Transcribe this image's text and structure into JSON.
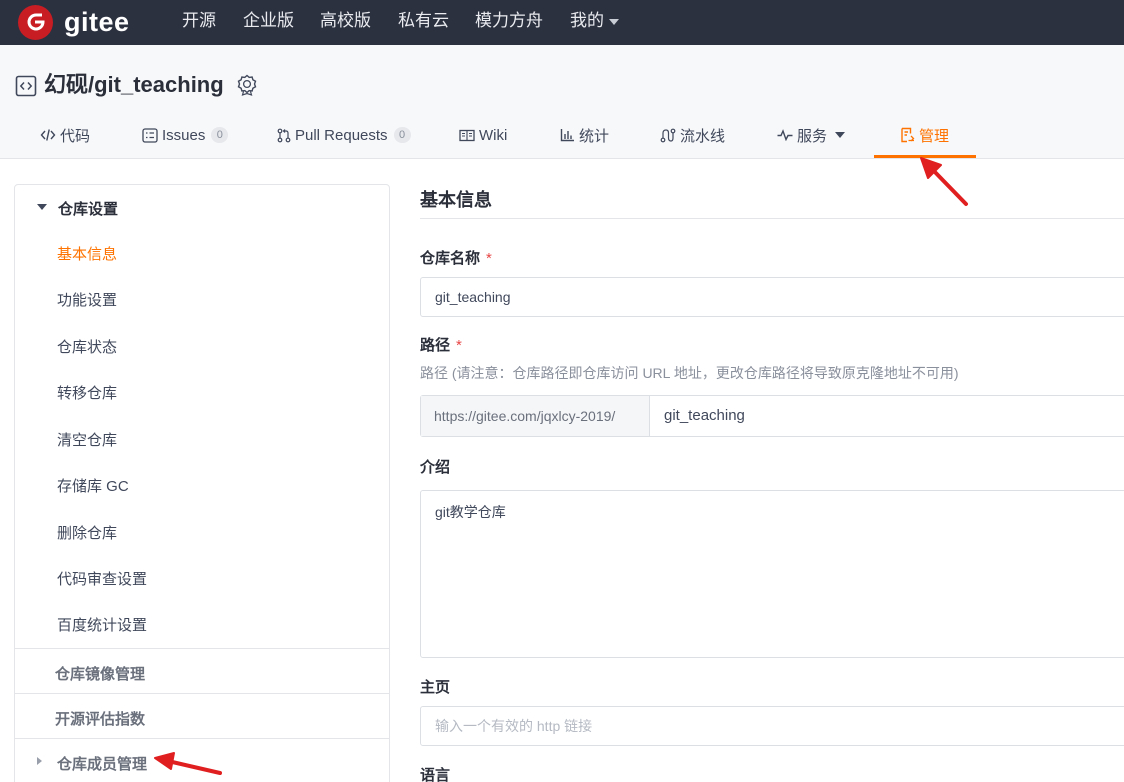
{
  "topbar": {
    "logo_text": "gitee",
    "nav": [
      {
        "label": "开源"
      },
      {
        "label": "企业版"
      },
      {
        "label": "高校版"
      },
      {
        "label": "私有云"
      },
      {
        "label": "模力方舟"
      },
      {
        "label": "我的"
      }
    ]
  },
  "project": {
    "title": "幻砚/git_teaching",
    "tabs": [
      {
        "label": "代码",
        "icon": "code-icon"
      },
      {
        "label": "Issues",
        "count": "0",
        "icon": "issues-icon"
      },
      {
        "label": "Pull Requests",
        "count": "0",
        "icon": "pull-request-icon"
      },
      {
        "label": "Wiki",
        "icon": "wiki-icon"
      },
      {
        "label": "统计",
        "icon": "chart-icon"
      },
      {
        "label": "流水线",
        "icon": "pipeline-icon"
      },
      {
        "label": "服务",
        "icon": "pulse-icon"
      },
      {
        "label": "管理",
        "icon": "manage-icon",
        "active": true
      }
    ]
  },
  "sidebar": {
    "group_title": "仓库设置",
    "items": [
      {
        "label": "基本信息",
        "active": true
      },
      {
        "label": "功能设置"
      },
      {
        "label": "仓库状态"
      },
      {
        "label": "转移仓库"
      },
      {
        "label": "清空仓库"
      },
      {
        "label": "存储库 GC"
      },
      {
        "label": "删除仓库"
      },
      {
        "label": "代码审查设置"
      },
      {
        "label": "百度统计设置"
      }
    ],
    "groups": [
      {
        "label": "仓库镜像管理"
      },
      {
        "label": "开源评估指数"
      },
      {
        "label": "仓库成员管理"
      }
    ]
  },
  "form": {
    "section_title": "基本信息",
    "repo_name_label": "仓库名称",
    "repo_name_value": "git_teaching",
    "path_label": "路径",
    "path_hint": "路径 (请注意：仓库路径即仓库访问 URL 地址，更改仓库路径将导致原克隆地址不可用)",
    "path_prefix": "https://gitee.com/jqxlcy-2019/",
    "path_value": "git_teaching",
    "intro_label": "介绍",
    "intro_value": "git教学仓库",
    "homepage_label": "主页",
    "homepage_placeholder": "输入一个有效的 http 链接",
    "language_label": "语言",
    "required_mark": "*"
  },
  "colors": {
    "topbar_bg": "#2c3140",
    "brand_red": "#c71d23",
    "accent_orange": "#fe7300",
    "annotation_arrow": "#e02020"
  }
}
